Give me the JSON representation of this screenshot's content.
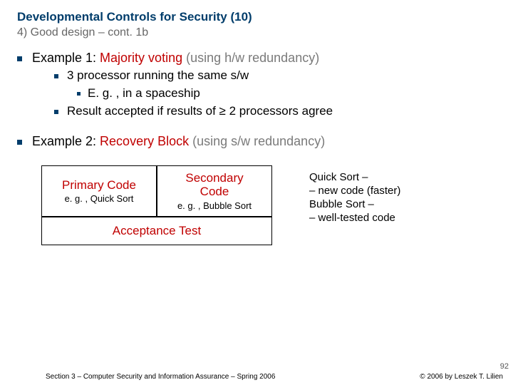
{
  "title": "Developmental Controls for Security (10)",
  "subtitle": "4)  Good design – cont. 1b",
  "ex1": {
    "lead": "Example 1: ",
    "name": "Majority voting ",
    "note": "(using h/w redundancy)",
    "b1": "3 processor running the same s/w",
    "b1a": "E. g. , in a spaceship",
    "b2": "Result accepted if results of ≥ 2 processors agree"
  },
  "ex2": {
    "lead": "Example 2: ",
    "name": "Recovery Block ",
    "note": "(using s/w redundancy)"
  },
  "boxes": {
    "primary_t": "Primary Code",
    "primary_s": "e. g. , Quick Sort",
    "secondary_t1": "Secondary",
    "secondary_t2": "Code",
    "secondary_s": "e. g. , Bubble Sort",
    "acc": "Acceptance Test"
  },
  "notes": {
    "l1": "Quick Sort –",
    "l2": "– new code (faster)",
    "l3": "Bubble Sort –",
    "l4": "– well-tested code"
  },
  "footer_left": "Section 3 – Computer Security and Information Assurance – Spring 2006",
  "footer_right": "© 2006 by Leszek T. Lilien",
  "page": "92"
}
